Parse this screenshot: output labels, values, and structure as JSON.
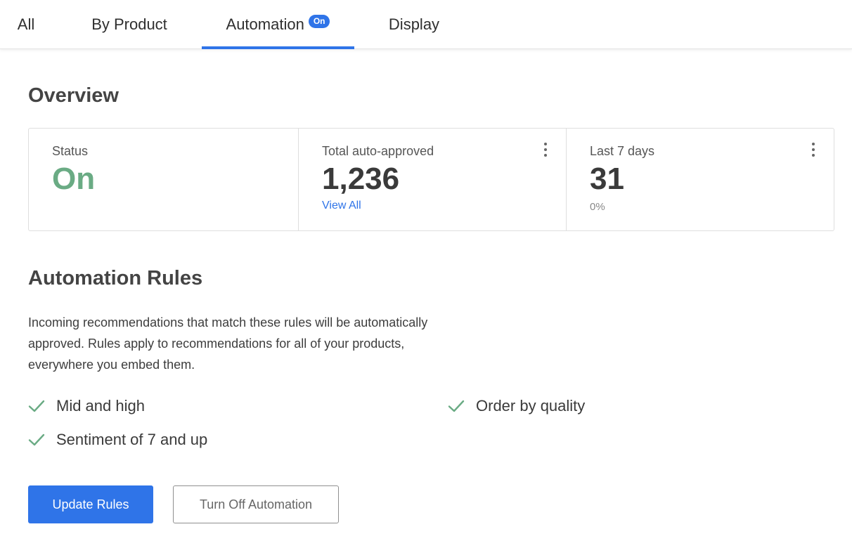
{
  "tabs": [
    {
      "label": "All"
    },
    {
      "label": "By Product"
    },
    {
      "label": "Automation",
      "badge": "On",
      "active": true
    },
    {
      "label": "Display"
    }
  ],
  "overview": {
    "title": "Overview",
    "status": {
      "label": "Status",
      "value": "On"
    },
    "total": {
      "label": "Total auto-approved",
      "value": "1,236",
      "link": "View All"
    },
    "last7": {
      "label": "Last 7 days",
      "value": "31",
      "change": "0%"
    }
  },
  "rules": {
    "title": "Automation Rules",
    "description": "Incoming recommendations that match these rules will be automatically approved. Rules apply to recommendations for all of your products, everywhere you embed them.",
    "items": [
      {
        "label": "Mid and high"
      },
      {
        "label": "Sentiment of 7 and up"
      },
      {
        "label": "Order by quality"
      }
    ]
  },
  "actions": {
    "update": "Update Rules",
    "turn_off": "Turn Off Automation"
  },
  "colors": {
    "accent": "#2f74e8",
    "status_on": "#6aab84",
    "check": "#6aab84"
  },
  "icons": {
    "check": "check-icon",
    "more": "more-vertical-icon"
  }
}
